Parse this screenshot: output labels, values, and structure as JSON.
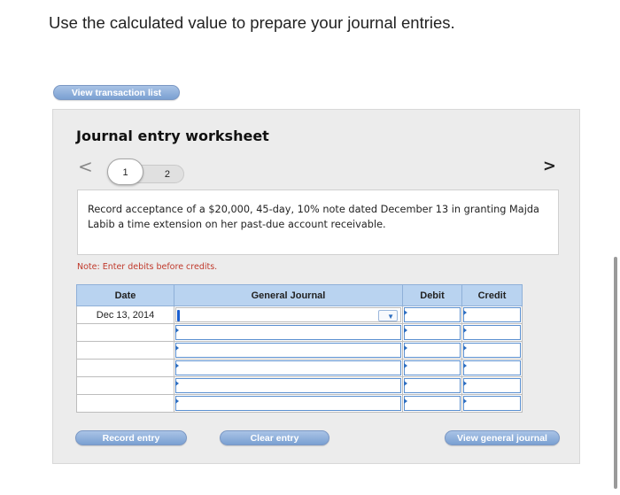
{
  "instruction": "Use the calculated value to prepare your journal entries.",
  "view_transaction_list_label": "View transaction list",
  "worksheet": {
    "title": "Journal entry worksheet",
    "tabs": [
      "1",
      "2"
    ],
    "prev_icon": "<",
    "next_icon": ">",
    "description": "Record acceptance of a $20,000, 45-day, 10% note dated December 13 in granting Majda Labib a time extension on her past-due account receivable.",
    "note": "Note: Enter debits before credits.",
    "table": {
      "headers": [
        "Date",
        "General Journal",
        "Debit",
        "Credit"
      ],
      "rows": [
        {
          "date": "Dec 13, 2014",
          "account": "",
          "debit": "",
          "credit": ""
        },
        {
          "date": "",
          "account": "",
          "debit": "",
          "credit": ""
        },
        {
          "date": "",
          "account": "",
          "debit": "",
          "credit": ""
        },
        {
          "date": "",
          "account": "",
          "debit": "",
          "credit": ""
        },
        {
          "date": "",
          "account": "",
          "debit": "",
          "credit": ""
        },
        {
          "date": "",
          "account": "",
          "debit": "",
          "credit": ""
        }
      ]
    },
    "buttons": {
      "record": "Record entry",
      "clear": "Clear entry",
      "view_general_journal": "View general journal"
    }
  }
}
